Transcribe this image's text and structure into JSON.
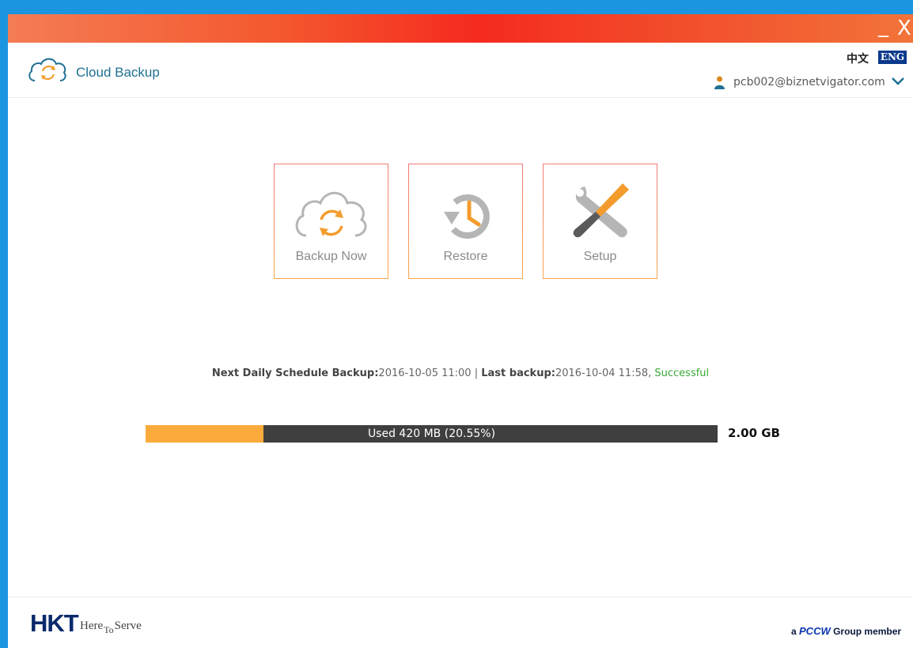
{
  "titlebar": {
    "minimize_label": "_",
    "close_label": "X"
  },
  "app": {
    "title": "Cloud Backup",
    "logo_icon": "cloud-sync-icon"
  },
  "header": {
    "lang_zh": "中文",
    "lang_en": "ENG",
    "user_email": "pcb002@biznetvigator.com",
    "user_icon": "user-icon",
    "menu_icon": "chevron-down-icon"
  },
  "actions": [
    {
      "label": "Backup Now",
      "icon": "cloud-sync-icon"
    },
    {
      "label": "Restore",
      "icon": "history-clock-icon"
    },
    {
      "label": "Setup",
      "icon": "tools-icon"
    }
  ],
  "schedule": {
    "next_label": "Next Daily Schedule Backup:",
    "next_value": "2016-10-05 11:00",
    "separator": " | ",
    "last_label": "Last backup:",
    "last_value": "2016-10-04 11:58",
    "last_status_sep": ", ",
    "last_status": "Successful"
  },
  "storage": {
    "used_text": "Used 420 MB (20.55%)",
    "used_percent": 20.55,
    "total": "2.00 GB"
  },
  "footer": {
    "brand": "HKT",
    "slogan_here": "Here",
    "slogan_to": "To",
    "slogan_serve": "Serve",
    "pccw_prefix": "a ",
    "pccw_brand": "PCCW",
    "pccw_suffix": " Group member"
  },
  "colors": {
    "accent_orange": "#fbab3b",
    "bar_dark": "#3f3f3f",
    "success_green": "#3aaa35",
    "title_blue": "#1f6f93"
  }
}
